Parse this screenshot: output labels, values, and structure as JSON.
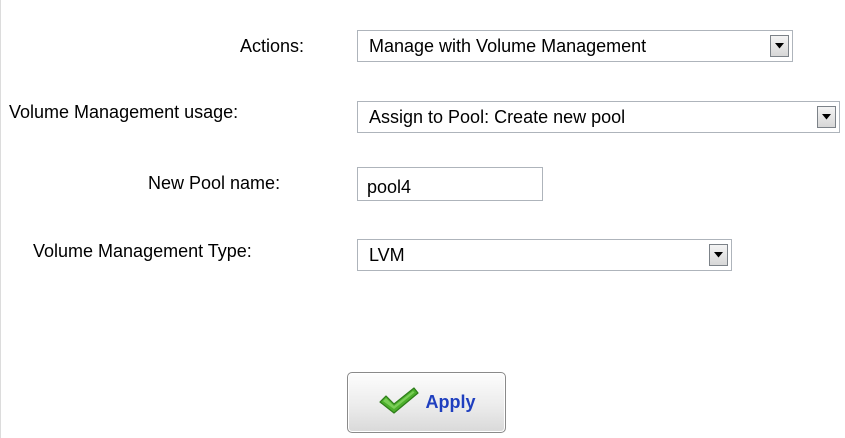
{
  "form": {
    "actions": {
      "label": "Actions:",
      "value": "Manage with Volume Management"
    },
    "usage": {
      "label": "Volume Management usage:",
      "value": "Assign to Pool: Create new pool"
    },
    "pool_name": {
      "label": "New Pool name:",
      "value": "pool4"
    },
    "type": {
      "label": "Volume Management Type:",
      "value": "LVM"
    }
  },
  "apply_button": {
    "label": "Apply",
    "icon": "checkmark-icon"
  },
  "colors": {
    "apply_text": "#1f3fbf",
    "check_green": "#4caf2c"
  }
}
